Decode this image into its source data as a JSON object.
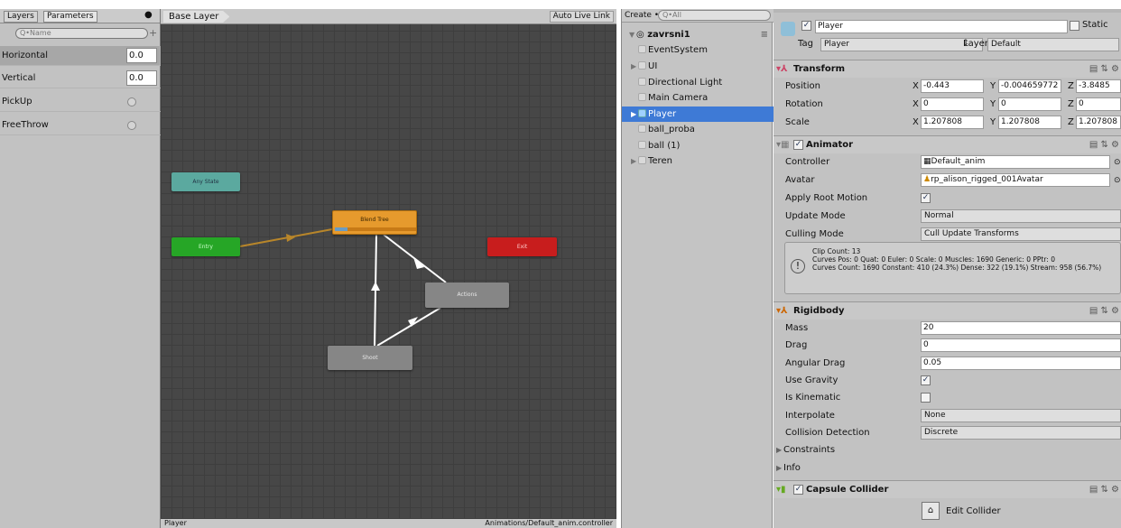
{
  "params": {
    "tabs": [
      "Layers",
      "Parameters"
    ],
    "search_placeholder": "Q•Name",
    "add_icon": "plus-icon",
    "items": [
      {
        "name": "Horizontal",
        "value": "0.0",
        "type": "float"
      },
      {
        "name": "Vertical",
        "value": "0.0",
        "type": "float"
      },
      {
        "name": "PickUp",
        "value": "",
        "type": "trigger"
      },
      {
        "name": "FreeThrow",
        "value": "",
        "type": "trigger"
      }
    ]
  },
  "graph": {
    "layer": "Base Layer",
    "auto_live": "Auto Live Link",
    "nodes": {
      "any": "Any State",
      "entry": "Entry",
      "blend": "Blend Tree",
      "exit": "Exit",
      "actions": "Actions",
      "shoot": "Shoot"
    },
    "status_left": "Player",
    "status_right": "Animations/Default_anim.controller"
  },
  "hierarchy": {
    "create": "Create •",
    "search_placeholder": "Q•All",
    "scene": "zavrsni1",
    "items": [
      "EventSystem",
      "UI",
      "Directional Light",
      "Main Camera",
      "Player",
      "ball_proba",
      "ball (1)",
      "Teren"
    ],
    "selected": "Player"
  },
  "inspector": {
    "name": "Player",
    "static": "Static",
    "tag_label": "Tag",
    "tag": "Player",
    "layer_label": "Layer",
    "layer": "Default",
    "transform": {
      "title": "Transform",
      "position_label": "Position",
      "rotation_label": "Rotation",
      "scale_label": "Scale",
      "position": [
        "-0.443",
        "-0.004659772",
        "-3.8485"
      ],
      "rotation": [
        "0",
        "0",
        "0"
      ],
      "scale": [
        "1.207808",
        "1.207808",
        "1.207808"
      ],
      "x": "X",
      "y": "Y",
      "z": "Z"
    },
    "animator": {
      "title": "Animator",
      "controller_label": "Controller",
      "controller": "Default_anim",
      "avatar_label": "Avatar",
      "avatar": "rp_alison_rigged_001Avatar",
      "root_motion_label": "Apply Root Motion",
      "update_mode_label": "Update Mode",
      "update_mode": "Normal",
      "culling_label": "Culling Mode",
      "culling": "Cull Update Transforms",
      "info1": "Clip Count: 13",
      "info2": "Curves Pos: 0 Quat: 0 Euler: 0 Scale: 0 Muscles: 1690 Generic: 0 PPtr: 0",
      "info3": "Curves Count: 1690 Constant: 410 (24.3%) Dense: 322 (19.1%) Stream: 958 (56.7%)"
    },
    "rigidbody": {
      "title": "Rigidbody",
      "mass_label": "Mass",
      "mass": "20",
      "drag_label": "Drag",
      "drag": "0",
      "angular_label": "Angular Drag",
      "angular": "0.05",
      "gravity_label": "Use Gravity",
      "kinematic_label": "Is Kinematic",
      "interp_label": "Interpolate",
      "interp": "None",
      "collision_label": "Collision Detection",
      "collision": "Discrete",
      "constraints": "Constraints",
      "info": "Info"
    },
    "capsule": {
      "title": "Capsule Collider",
      "edit": "Edit Collider"
    }
  }
}
